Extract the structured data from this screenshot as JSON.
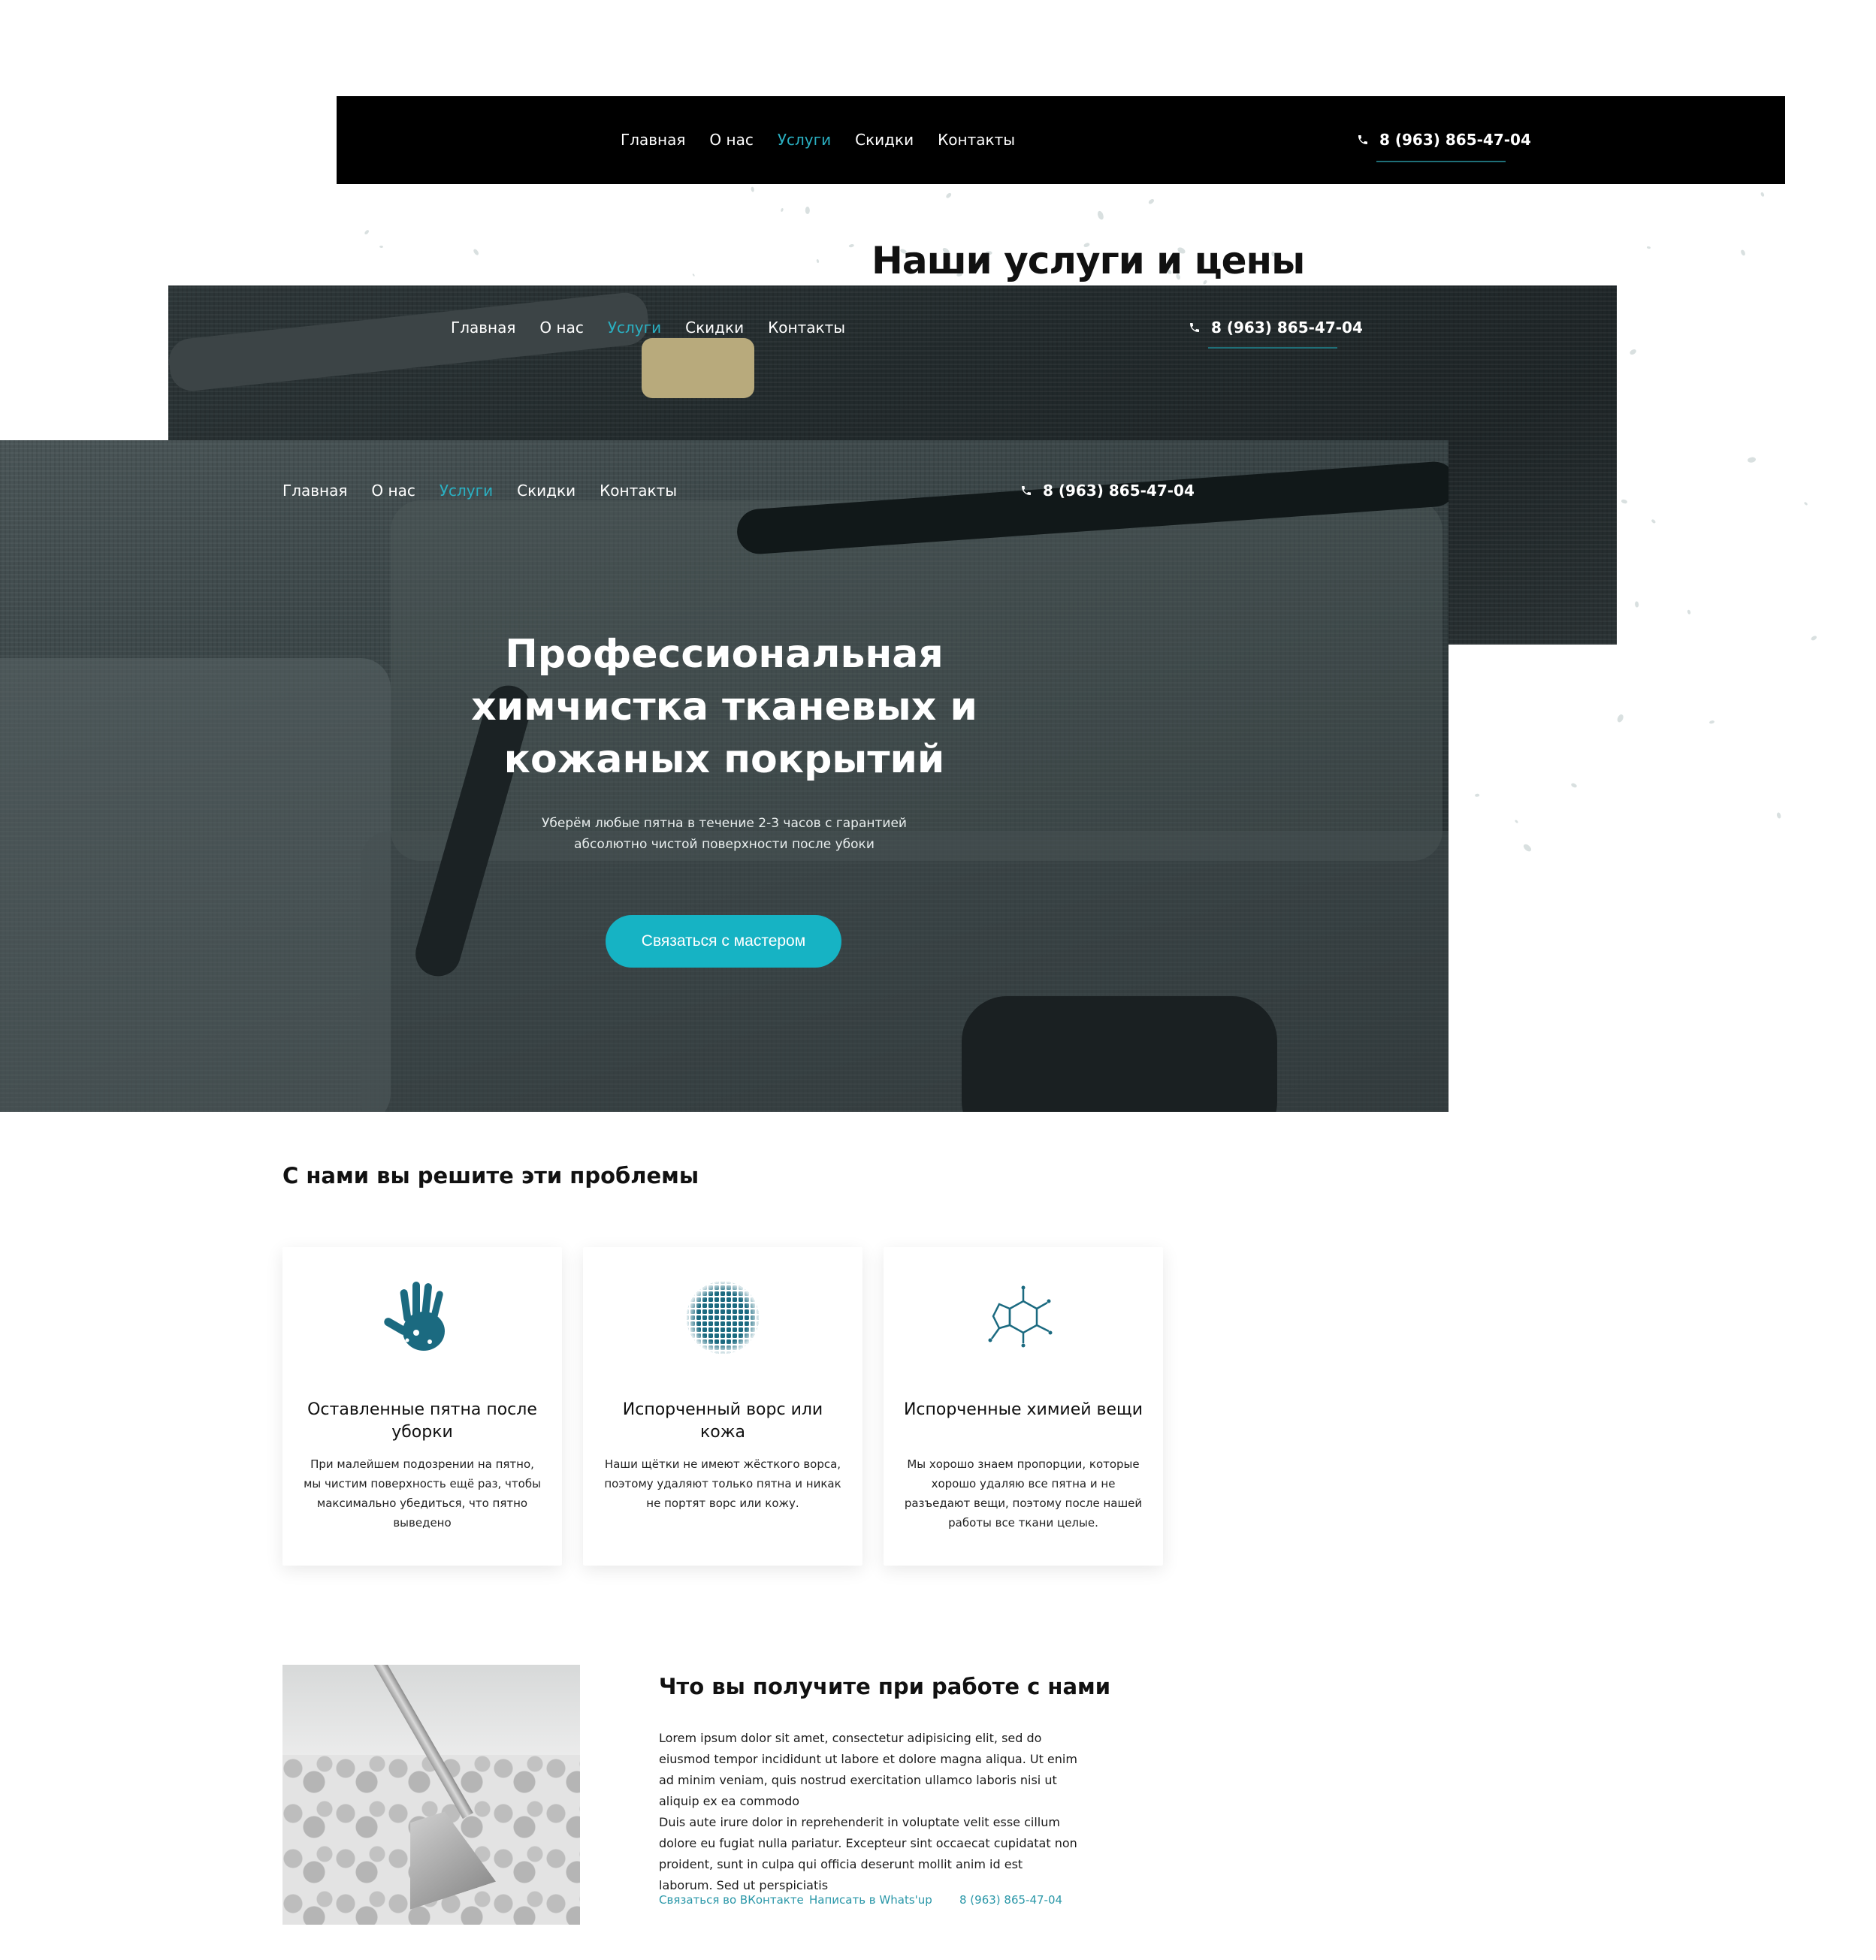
{
  "nav": {
    "items": [
      {
        "label": "Главная",
        "active": false
      },
      {
        "label": "О нас",
        "active": false
      },
      {
        "label": "Услуги",
        "active": true
      },
      {
        "label": "Скидки",
        "active": false
      },
      {
        "label": "Контакты",
        "active": false
      }
    ],
    "phone": "8 (963) 865-47-04"
  },
  "layer1": {
    "title": "Наши услуги и цены"
  },
  "hero": {
    "title": "Профессиональная химчистка тканевых и кожаных покрытий",
    "subtitle": "Уберём любые пятна в течение 2-3 часов с гарантией абсолютно чистой поверхности после убоки",
    "cta": "Связаться с мастером"
  },
  "problems": {
    "title": "С нами вы решите эти проблемы",
    "cards": [
      {
        "icon": "handprint-icon",
        "title": "Оставленные пятна после уборки",
        "text": "При малейшем подозрении на пятно, мы чистим поверхность ещё раз, чтобы максимально убедиться, что пятно выведено"
      },
      {
        "icon": "fabric-sphere-icon",
        "title": "Испорченный ворс или кожа",
        "text": "Наши щётки не имеют жёсткого ворса, поэтому удаляют только пятна и никак не портят ворс или кожу."
      },
      {
        "icon": "molecule-icon",
        "title": "Испорченные химией вещи",
        "text": "Мы хорошо знаем пропорции, которые хорошо удаляю все пятна и не разъедают вещи, поэтому после нашей работы все ткани целые."
      }
    ]
  },
  "benefits": {
    "title": "Что вы получите при работе с нами",
    "p1": "Lorem ipsum dolor sit amet, consectetur adipisicing elit, sed do eiusmod tempor incididunt ut labore et dolore magna aliqua. Ut enim ad minim veniam, quis nostrud exercitation ullamco laboris nisi ut aliquip ex ea commodo",
    "p2": "Duis aute irure dolor in reprehenderit in voluptate velit esse cillum dolore eu fugiat nulla pariatur. Excepteur sint occaecat cupidatat non proident, sunt in culpa qui officia deserunt mollit anim id est laborum. Sed ut perspiciatis",
    "links": [
      "Связаться во ВКонтакте",
      "Написать в Whats'up",
      "8 (963) 865-47-04"
    ]
  },
  "colors": {
    "accent": "#16b3c4",
    "active_nav": "#2ab0c2",
    "icon": "#1b6a80",
    "link": "#2a97a8"
  }
}
